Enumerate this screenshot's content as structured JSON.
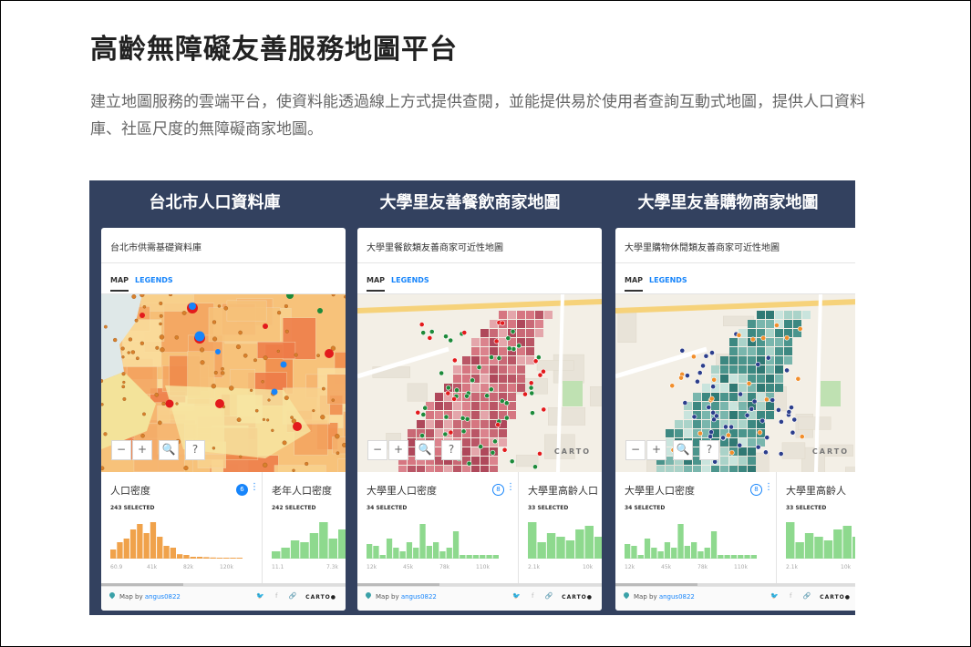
{
  "page": {
    "title": "高齡無障礙友善服務地圖平台",
    "description": "建立地圖服務的雲端平台，使資料能透過線上方式提供查閱，並能提供易於使用者查詢互動式地圖，提供人口資料庫、社區尺度的無障礙商家地圖。"
  },
  "panels": [
    {
      "title": "台北市人口資料庫",
      "subtitle": "台北市供需基礎資料庫",
      "tabs": {
        "map": "MAP",
        "legends": "LEGENDS"
      },
      "zoom": {
        "minus": "−",
        "plus": "+",
        "search": "🔍",
        "help": "?"
      },
      "carto_watermark": "",
      "widgets": [
        {
          "title": "人口密度",
          "selected": "243 SELECTED",
          "badge": "6",
          "badge_filled": true,
          "axis": [
            "60.9",
            "41k",
            "82k",
            "120k"
          ],
          "color": "#f0a24b",
          "bars": [
            0.25,
            0.45,
            0.55,
            0.8,
            0.95,
            0.7,
            1.0,
            0.6,
            0.35,
            0.3,
            0.12,
            0.1,
            0.05,
            0.05,
            0.04,
            0.03,
            0.02,
            0.02,
            0.02,
            0.02
          ]
        },
        {
          "title": "老年人口密度",
          "selected": "242 SELECTED",
          "axis": [
            "11.1",
            "7.3k"
          ],
          "color": "#8ed98e",
          "bars": [
            0.2,
            0.3,
            0.5,
            0.45,
            0.7,
            1.0,
            0.55,
            0.8,
            0.6,
            0.75,
            0.4,
            0.2,
            0.15,
            0.1
          ]
        }
      ],
      "footer": {
        "map_by": "Map by ",
        "author": "angus0822",
        "share": "🐦 f 🔗",
        "carto": "CARTO●"
      }
    },
    {
      "title": "大學里友善餐飲商家地圖",
      "subtitle": "大學里餐飲類友善商家可近性地圖",
      "tabs": {
        "map": "MAP",
        "legends": "LEGENDS"
      },
      "zoom": {
        "minus": "−",
        "plus": "+",
        "search": "🔍",
        "help": "?"
      },
      "carto_watermark": "CARTO",
      "widgets": [
        {
          "title": "大學里人口密度",
          "selected": "34 SELECTED",
          "badge": "8",
          "badge_filled": false,
          "axis": [
            "12k",
            "45k",
            "78k",
            "110k"
          ],
          "color": "#8ed98e",
          "bars": [
            0.4,
            0.35,
            0.1,
            0.55,
            0.3,
            0.2,
            0.45,
            0.3,
            0.95,
            0.35,
            0.45,
            0.2,
            0.3,
            0.75,
            0.1,
            0.1,
            0.1,
            0.1,
            0.1,
            0.1
          ]
        },
        {
          "title": "大學里高齡人口",
          "selected": "33 SELECTED",
          "axis": [
            "2.1k",
            "10k"
          ],
          "color": "#8ed98e",
          "bars": [
            1.0,
            0.45,
            0.7,
            0.6,
            0.5,
            0.8,
            0.9,
            0.6,
            0.75,
            0.6,
            0.8,
            0.7,
            0.9,
            0.5
          ]
        }
      ],
      "footer": {
        "map_by": "Map by ",
        "author": "angus0822",
        "share": "🐦 f 🔗",
        "carto": "CARTO●"
      }
    },
    {
      "title": "大學里友善購物商家地圖",
      "subtitle": "大學里購物休閒類友善商家可近性地圖",
      "tabs": {
        "map": "MAP",
        "legends": "LEGENDS"
      },
      "zoom": {
        "minus": "−",
        "plus": "+",
        "search": "🔍",
        "help": "?"
      },
      "carto_watermark": "CARTO",
      "widgets": [
        {
          "title": "大學里人口密度",
          "selected": "34 SELECTED",
          "badge": "8",
          "badge_filled": false,
          "axis": [
            "12k",
            "45k",
            "78k",
            "110k"
          ],
          "color": "#8ed98e",
          "bars": [
            0.4,
            0.35,
            0.1,
            0.55,
            0.3,
            0.2,
            0.45,
            0.3,
            0.95,
            0.35,
            0.45,
            0.2,
            0.3,
            0.75,
            0.1,
            0.1,
            0.1,
            0.1,
            0.1,
            0.1
          ]
        },
        {
          "title": "大學里高齡人",
          "selected": "33 SELECTED",
          "axis": [
            "2.1k",
            "10k"
          ],
          "color": "#8ed98e",
          "bars": [
            1.0,
            0.45,
            0.7,
            0.6,
            0.5,
            0.8,
            0.9,
            0.6,
            0.75,
            0.6,
            0.8,
            0.7,
            0.9,
            0.5
          ]
        }
      ],
      "footer": {
        "map_by": "Map by ",
        "author": "angus0822",
        "share": "🐦 f 🔗",
        "carto": "CARTO●"
      }
    }
  ],
  "colors": {
    "hero_bg": "#33415f",
    "accent_blue": "#1785fb",
    "dot_red": "#e31a1c",
    "dot_green": "#1d8a3a",
    "dot_orange": "#f28e2b",
    "dot_navy": "#2c3e8c"
  }
}
